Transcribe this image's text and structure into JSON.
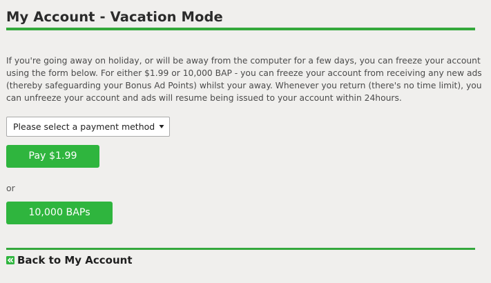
{
  "header": {
    "title": "My Account - Vacation Mode"
  },
  "main": {
    "intro_text": "If you're going away on holiday, or will be away from the computer for a few days, you can freeze your account using the form below. For either $1.99 or 10,000 BAP - you can freeze your account from receiving any new ads (thereby safeguarding your Bonus Ad Points) whilst your away. Whenever you return (there's no time limit), you can unfreeze your account and ads will resume being issued to your account within 24hours.",
    "payment_select": {
      "selected": "Please select a payment method",
      "arrow_icon": "triangle-down-icon"
    },
    "pay_button_label": "Pay $1.99",
    "or_text": "or",
    "baps_button_label": "10,000 BAPs"
  },
  "footer": {
    "back_icon": "double-chevron-left-icon",
    "back_link_label": "Back to My Account"
  },
  "colors": {
    "accent_green": "#34a83c",
    "button_green": "#2fb53e",
    "background": "#f0efed"
  }
}
